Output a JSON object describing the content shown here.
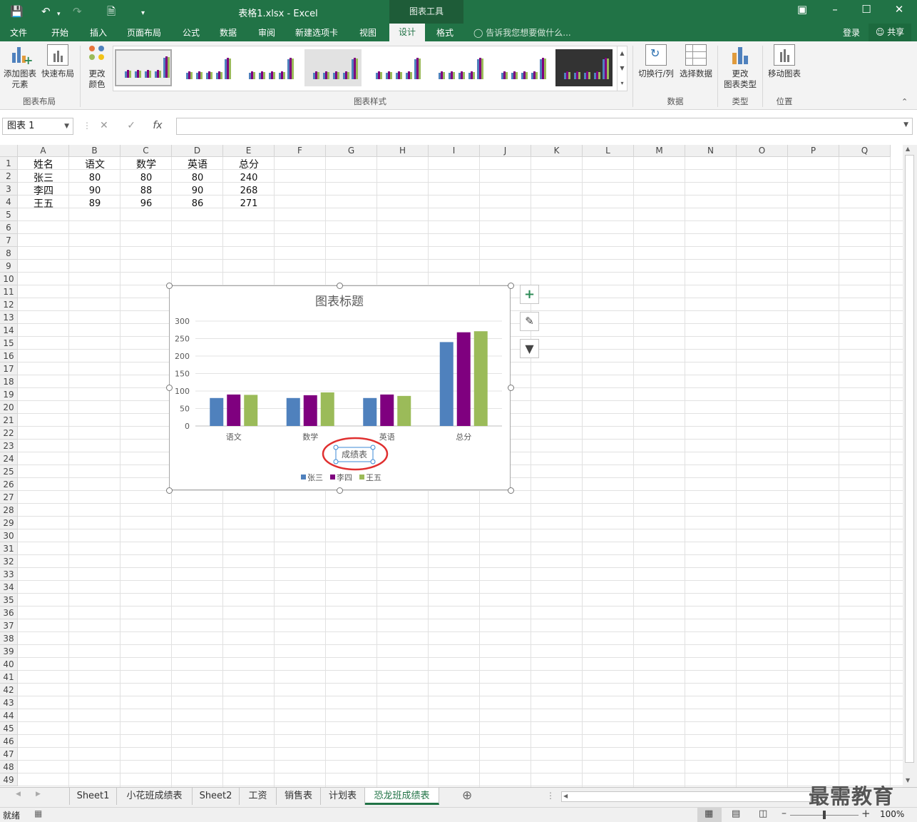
{
  "titlebar": {
    "title": "表格1.xlsx - Excel",
    "context_tools": "图表工具"
  },
  "tabs": [
    "文件",
    "开始",
    "插入",
    "页面布局",
    "公式",
    "数据",
    "审阅",
    "新建选项卡",
    "视图",
    "设计",
    "格式"
  ],
  "active_tab": "设计",
  "tell_me": "告诉我您想要做什么...",
  "login": "登录",
  "share": "共享",
  "ribbon": {
    "add_element": "添加图表\n元素",
    "quick_layout": "快速布局",
    "change_color": "更改\n颜色",
    "group_layout": "图表布局",
    "group_styles": "图表样式",
    "switch_rowcol": "切换行/列",
    "select_data": "选择数据",
    "group_data": "数据",
    "change_type": "更改\n图表类型",
    "group_type": "类型",
    "move_chart": "移动图表",
    "group_location": "位置"
  },
  "namebox": "图表 1",
  "formula": "",
  "columns": [
    "A",
    "B",
    "C",
    "D",
    "E",
    "F",
    "G",
    "H",
    "I",
    "J",
    "K",
    "L",
    "M",
    "N",
    "O",
    "P",
    "Q"
  ],
  "table": {
    "header": [
      "姓名",
      "语文",
      "数学",
      "英语",
      "总分"
    ],
    "rows": [
      [
        "张三",
        "80",
        "80",
        "80",
        "240"
      ],
      [
        "李四",
        "90",
        "88",
        "90",
        "268"
      ],
      [
        "王五",
        "89",
        "96",
        "86",
        "271"
      ]
    ]
  },
  "chart_data": {
    "type": "bar",
    "title": "图表标题",
    "xlabel": "成绩表",
    "ylabel": "",
    "categories": [
      "语文",
      "数学",
      "英语",
      "总分"
    ],
    "series": [
      {
        "name": "张三",
        "values": [
          80,
          80,
          80,
          240
        ],
        "color": "#4f81bd"
      },
      {
        "name": "李四",
        "values": [
          90,
          88,
          90,
          268
        ],
        "color": "#7f007f"
      },
      {
        "name": "王五",
        "values": [
          89,
          96,
          86,
          271
        ],
        "color": "#9bbb59"
      }
    ],
    "ylim": [
      0,
      300
    ],
    "yticks": [
      0,
      50,
      100,
      150,
      200,
      250,
      300
    ],
    "grid": true,
    "legend": "bottom"
  },
  "sheets": [
    "Sheet1",
    "小花班成绩表",
    "Sheet2",
    "工资",
    "销售表",
    "计划表",
    "恐龙班成绩表"
  ],
  "active_sheet": "恐龙班成绩表",
  "status": {
    "ready": "就绪",
    "zoom": "100%"
  },
  "watermark": "最需教育",
  "colors": {
    "accent": "#217346",
    "highlight_ellipse": "#e03030"
  }
}
